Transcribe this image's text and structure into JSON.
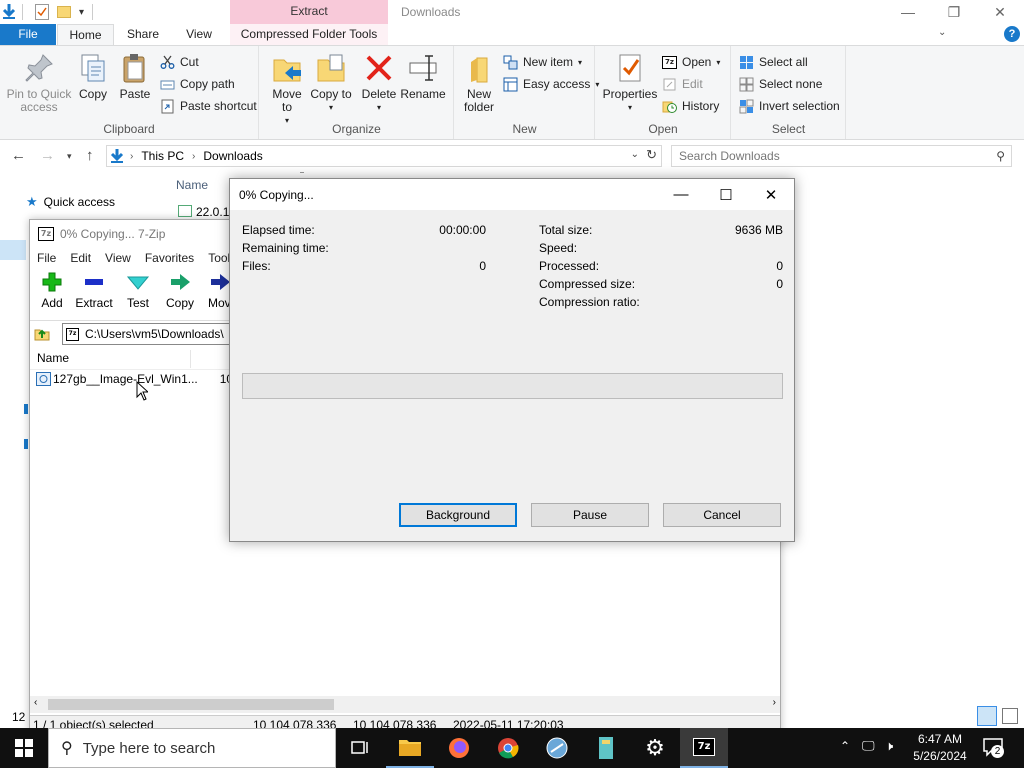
{
  "explorer": {
    "title": "Downloads",
    "contextual_group": "Extract",
    "tabs": [
      {
        "label": "File"
      },
      {
        "label": "Home"
      },
      {
        "label": "Share"
      },
      {
        "label": "View"
      },
      {
        "label": "Compressed Folder Tools"
      }
    ],
    "ribbon": {
      "clipboard": {
        "label": "Clipboard",
        "pin": "Pin to Quick access",
        "copy": "Copy",
        "paste": "Paste",
        "cut": "Cut",
        "copy_path": "Copy path",
        "paste_shortcut": "Paste shortcut"
      },
      "organize": {
        "label": "Organize",
        "move_to": "Move to",
        "copy_to": "Copy to",
        "delete": "Delete",
        "rename": "Rename"
      },
      "new": {
        "label": "New",
        "new_folder": "New folder",
        "new_item": "New item",
        "easy_access": "Easy access"
      },
      "open": {
        "label": "Open",
        "properties": "Properties",
        "open": "Open",
        "edit": "Edit",
        "history": "History"
      },
      "select": {
        "label": "Select",
        "select_all": "Select all",
        "select_none": "Select none",
        "invert": "Invert selection"
      }
    },
    "address": {
      "root": "This PC",
      "current": "Downloads"
    },
    "search_placeholder": "Search Downloads",
    "nav_pane": {
      "quick_access": "Quick access"
    },
    "column_name": "Name",
    "partial_row_1": "22.0.1",
    "partial_status": "12"
  },
  "sevenzip": {
    "title": "0% Copying... 7-Zip",
    "menu": [
      "File",
      "Edit",
      "View",
      "Favorites",
      "Tools"
    ],
    "toolbar": {
      "add": "Add",
      "extract": "Extract",
      "test": "Test",
      "copy": "Copy",
      "move": "Mov"
    },
    "path": "C:\\Users\\vm5\\Downloads\\",
    "column_name": "Name",
    "file": {
      "name": "127gb__Image-Evl_Win1...",
      "size_partial": "10 1"
    },
    "status": {
      "selected": "1 / 1 object(s) selected",
      "size1": "10 104 078 336",
      "size2": "10 104 078 336",
      "modified": "2022-05-11 17:20:03"
    }
  },
  "dialog": {
    "title": "0% Copying...",
    "elapsed_label": "Elapsed time:",
    "elapsed_value": "00:00:00",
    "remaining_label": "Remaining time:",
    "files_label": "Files:",
    "files_value": "0",
    "total_label": "Total size:",
    "total_value": "9636 MB",
    "speed_label": "Speed:",
    "processed_label": "Processed:",
    "processed_value": "0",
    "compressed_label": "Compressed size:",
    "compressed_value": "0",
    "ratio_label": "Compression ratio:",
    "progress_fraction": 0,
    "buttons": {
      "background": "Background",
      "pause": "Pause",
      "cancel": "Cancel"
    }
  },
  "taskbar": {
    "search_placeholder": "Type here to search",
    "time": "6:47 AM",
    "date": "5/26/2024",
    "notification_count": "2"
  }
}
